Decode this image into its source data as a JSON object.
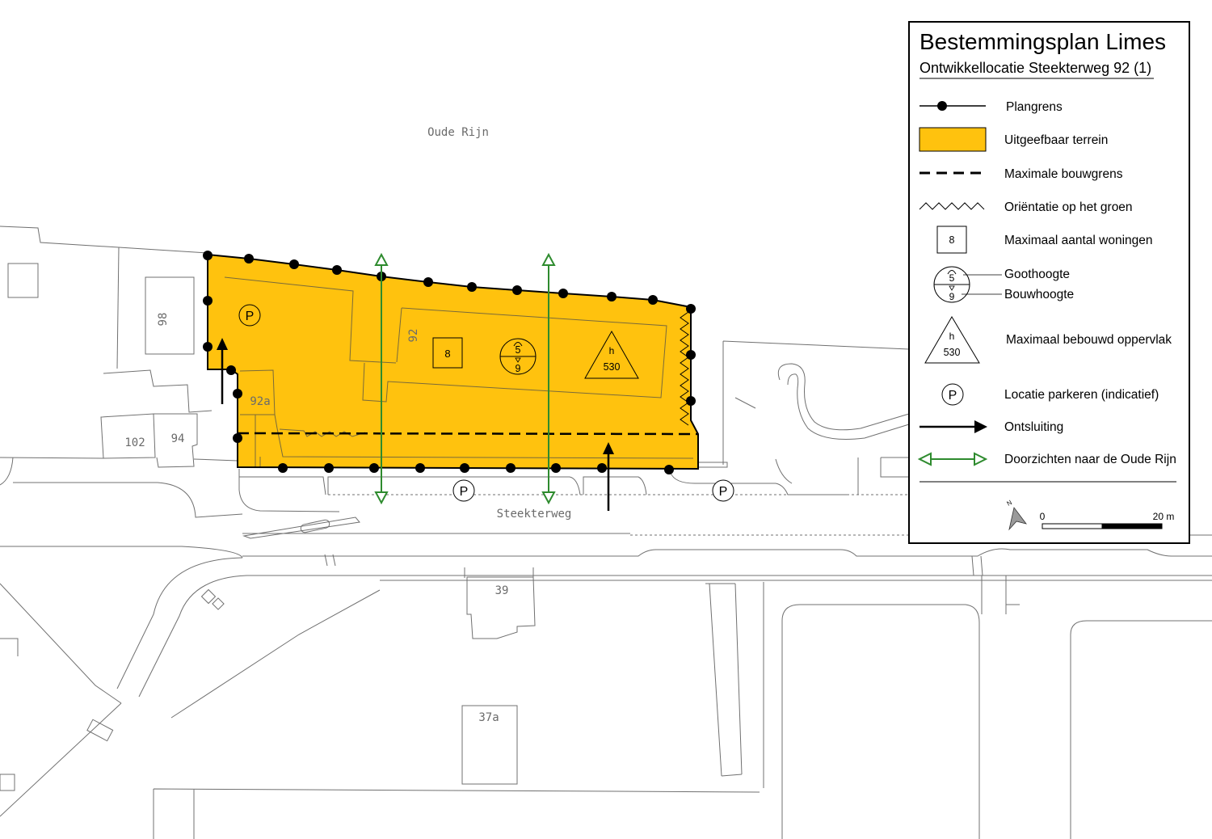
{
  "map": {
    "water_label": "Oude Rijn",
    "street_label": "Steekterweg",
    "house_numbers": {
      "n98": "98",
      "n92": "92",
      "n92a": "92a",
      "n102": "102",
      "n94": "94",
      "n39": "39",
      "n37a": "37a"
    },
    "plan_symbols": {
      "parking": "P",
      "max_dwellings": "8",
      "gutter_height": "5",
      "building_height": "9",
      "area_code": "h",
      "max_built_area": "530"
    }
  },
  "legend": {
    "title": "Bestemmingsplan Limes",
    "subtitle": "Ontwikkellocatie Steekterweg 92 (1)",
    "items": [
      {
        "label": "Plangrens"
      },
      {
        "label": "Uitgeefbaar terrein"
      },
      {
        "label": "Maximale bouwgrens"
      },
      {
        "label": "Oriëntatie op het groen"
      },
      {
        "symbol": "8",
        "label": "Maximaal aantal woningen"
      },
      {
        "symbol_top": "5",
        "symbol_bottom": "9",
        "label_top": "Goothoogte",
        "label_bottom": "Bouwhoogte"
      },
      {
        "symbol_top": "h",
        "symbol_bottom": "530",
        "label": "Maximaal bebouwd oppervlak"
      },
      {
        "symbol": "P",
        "label": "Locatie parkeren (indicatief)"
      },
      {
        "label": "Ontsluiting"
      },
      {
        "label": "Doorzichten naar de Oude Rijn"
      }
    ],
    "north_label": "N",
    "scale": {
      "start": "0",
      "end": "20 m"
    }
  },
  "colors": {
    "plan_fill": "#FFC20E",
    "sightline": "#2E8B2E",
    "base_line": "#707070"
  }
}
